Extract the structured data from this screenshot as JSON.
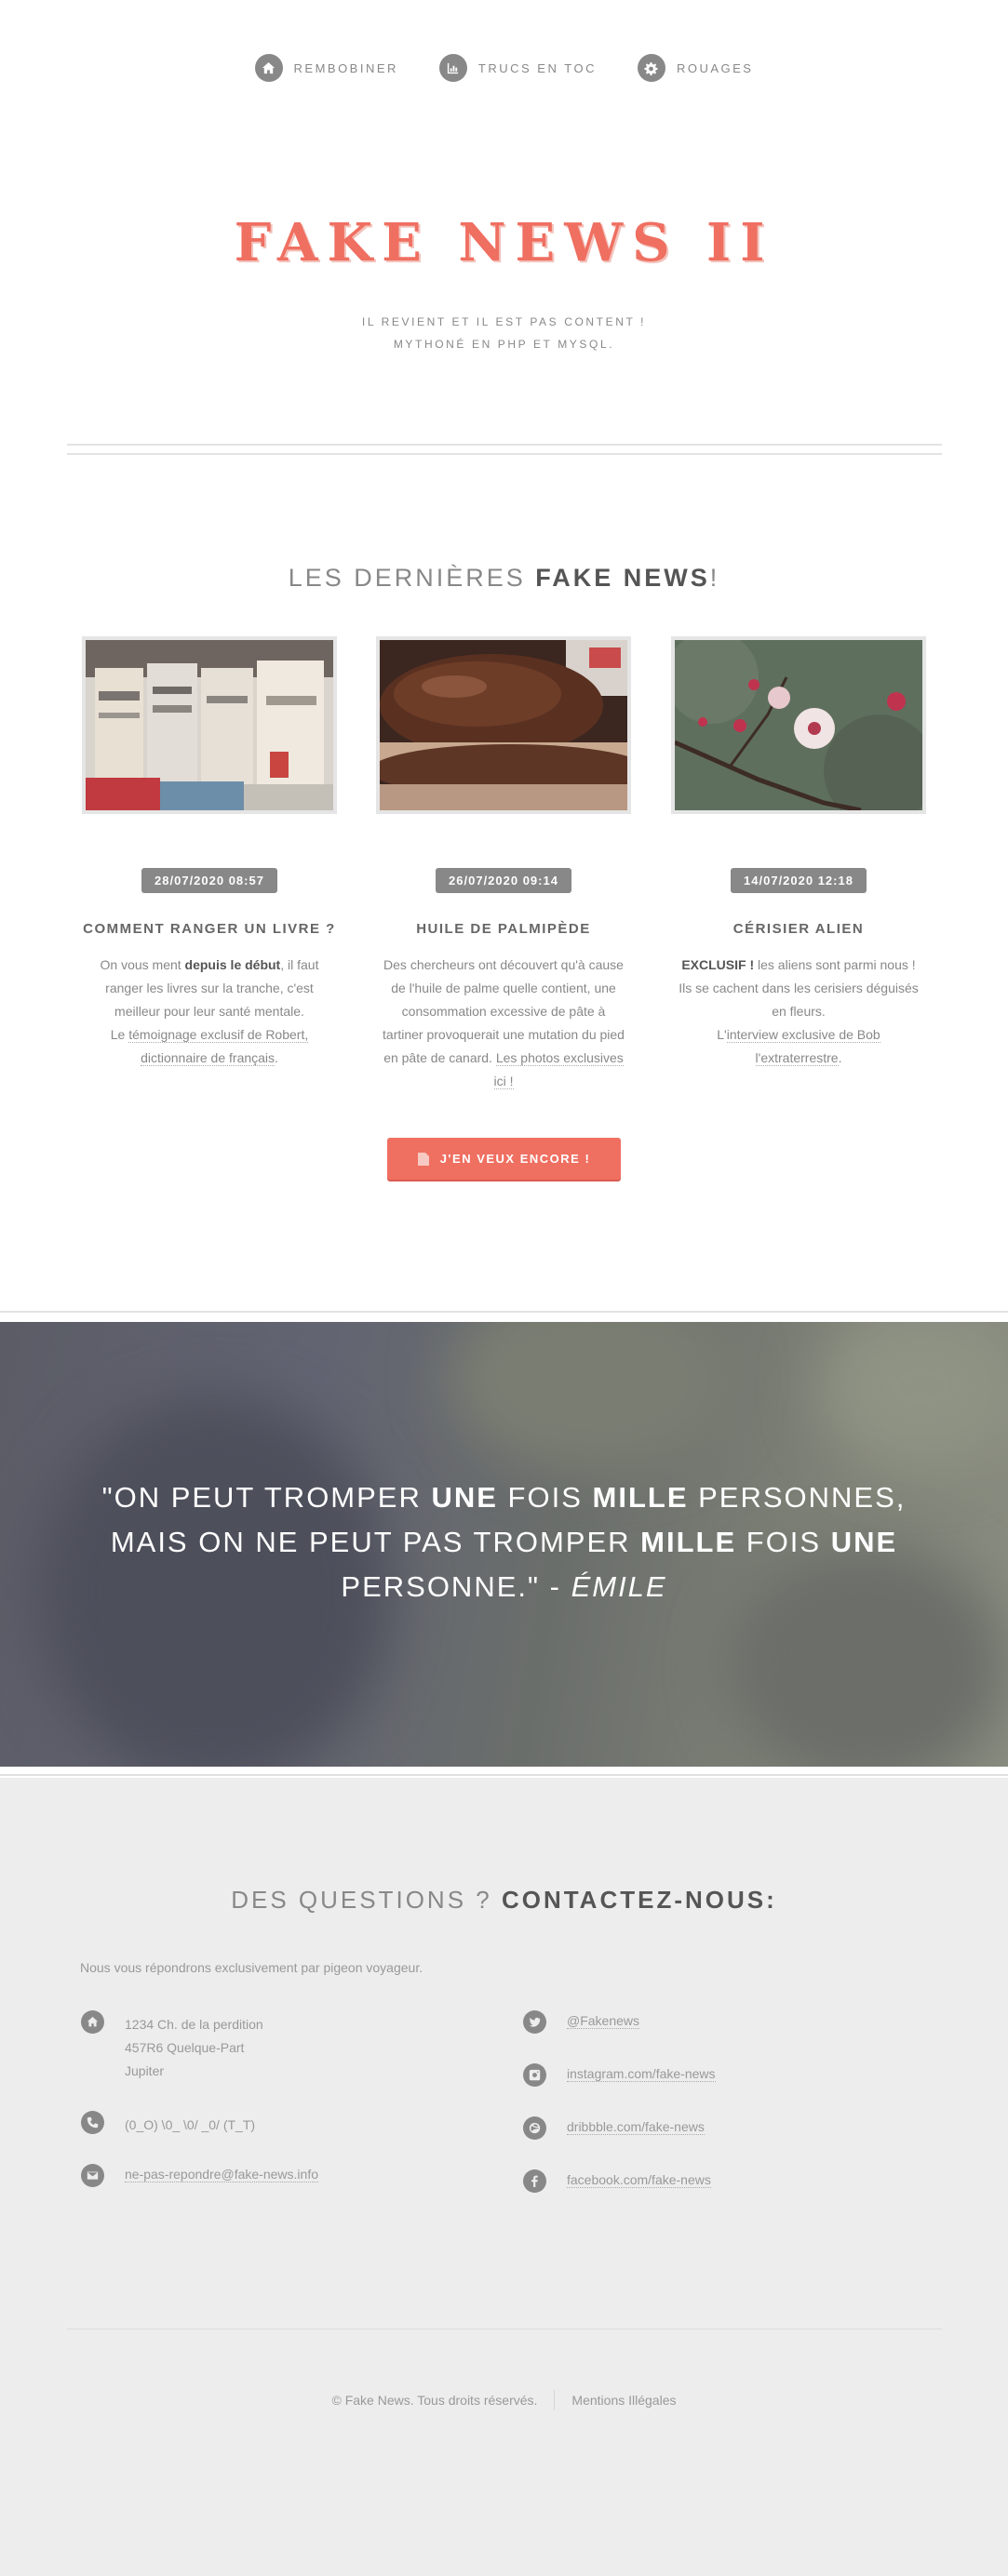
{
  "nav": {
    "items": [
      {
        "label": "Rembobiner",
        "icon": "home-icon"
      },
      {
        "label": "Trucs en toc",
        "icon": "bar-chart-icon"
      },
      {
        "label": "Rouages",
        "icon": "gear-icon"
      }
    ]
  },
  "hero": {
    "title": "FAKE NEWS II",
    "subtitle_line1": "Il revient et il est pas content !",
    "subtitle_line2": "Mythoné en PHP et MySQL."
  },
  "latest": {
    "title_prefix": "LES DERNIÈRES ",
    "title_bold": "FAKE NEWS",
    "title_suffix": "!",
    "cards": [
      {
        "date": "28/07/2020 08:57",
        "title": "COMMENT RANGER UN LIVRE ?",
        "t1": "On vous ment ",
        "t2": "depuis le début",
        "t3": ", il faut ranger les livres sur la tranche, c'est meilleur pour leur santé mentale.",
        "t4": "Le ",
        "link": "témoignage exclusif de Robert, dictionnaire de français",
        "t5": "."
      },
      {
        "date": "26/07/2020 09:14",
        "title": "HUILE DE PALMIPÈDE",
        "t1": "Des chercheurs ont découvert qu'à cause de l'huile de palme quelle contient, une consommation excessive de pâte à tartiner provoquerait une mutation du pied en pâte de canard. ",
        "link": "Les photos exclusives ici !"
      },
      {
        "date": "14/07/2020 12:18",
        "title": "CÉRISIER ALIEN",
        "t1": "EXCLUSIF !",
        "t2": " les aliens sont parmi nous ! Ils se cachent dans les cerisiers déguisés en fleurs.",
        "t3": "L'",
        "link": "interview exclusive de Bob l'extraterrestre",
        "t4": "."
      }
    ],
    "more_button": "J'EN VEUX ENCORE !"
  },
  "quote": {
    "p1": "\"ON PEUT TROMPER ",
    "b1": "UNE",
    "p2": " FOIS ",
    "b2": "MILLE",
    "p3": " PERSONNES,",
    "p4": "MAIS ON NE PEUT PAS TROMPER ",
    "b3": "MILLE",
    "p5": " FOIS ",
    "b4": "UNE",
    "p6": "PERSONNE.\" - ",
    "author": "ÉMILE"
  },
  "contact": {
    "title_prefix": "DES QUESTIONS ? ",
    "title_bold": "CONTACTEZ-NOUS:",
    "intro": "Nous vous répondrons exclusivement par pigeon voyageur.",
    "address_line1": "1234 Ch. de la perdition",
    "address_line2": "457R6 Quelque-Part",
    "address_line3": "Jupiter",
    "phone": "(0_O) \\0_ \\0/ _0/ (T_T)",
    "email": "ne-pas-repondre@fake-news.info",
    "twitter": "@Fakenews",
    "instagram": "instagram.com/fake-news",
    "dribbble": "dribbble.com/fake-news",
    "facebook": "facebook.com/fake-news"
  },
  "footer": {
    "copyright": "© Fake News. Tous droits réservés.",
    "legal": "Mentions Illégales"
  },
  "colors": {
    "accent": "#ef6f61",
    "text": "#888888",
    "dark_text": "#555555",
    "contact_bg": "#ededed"
  }
}
